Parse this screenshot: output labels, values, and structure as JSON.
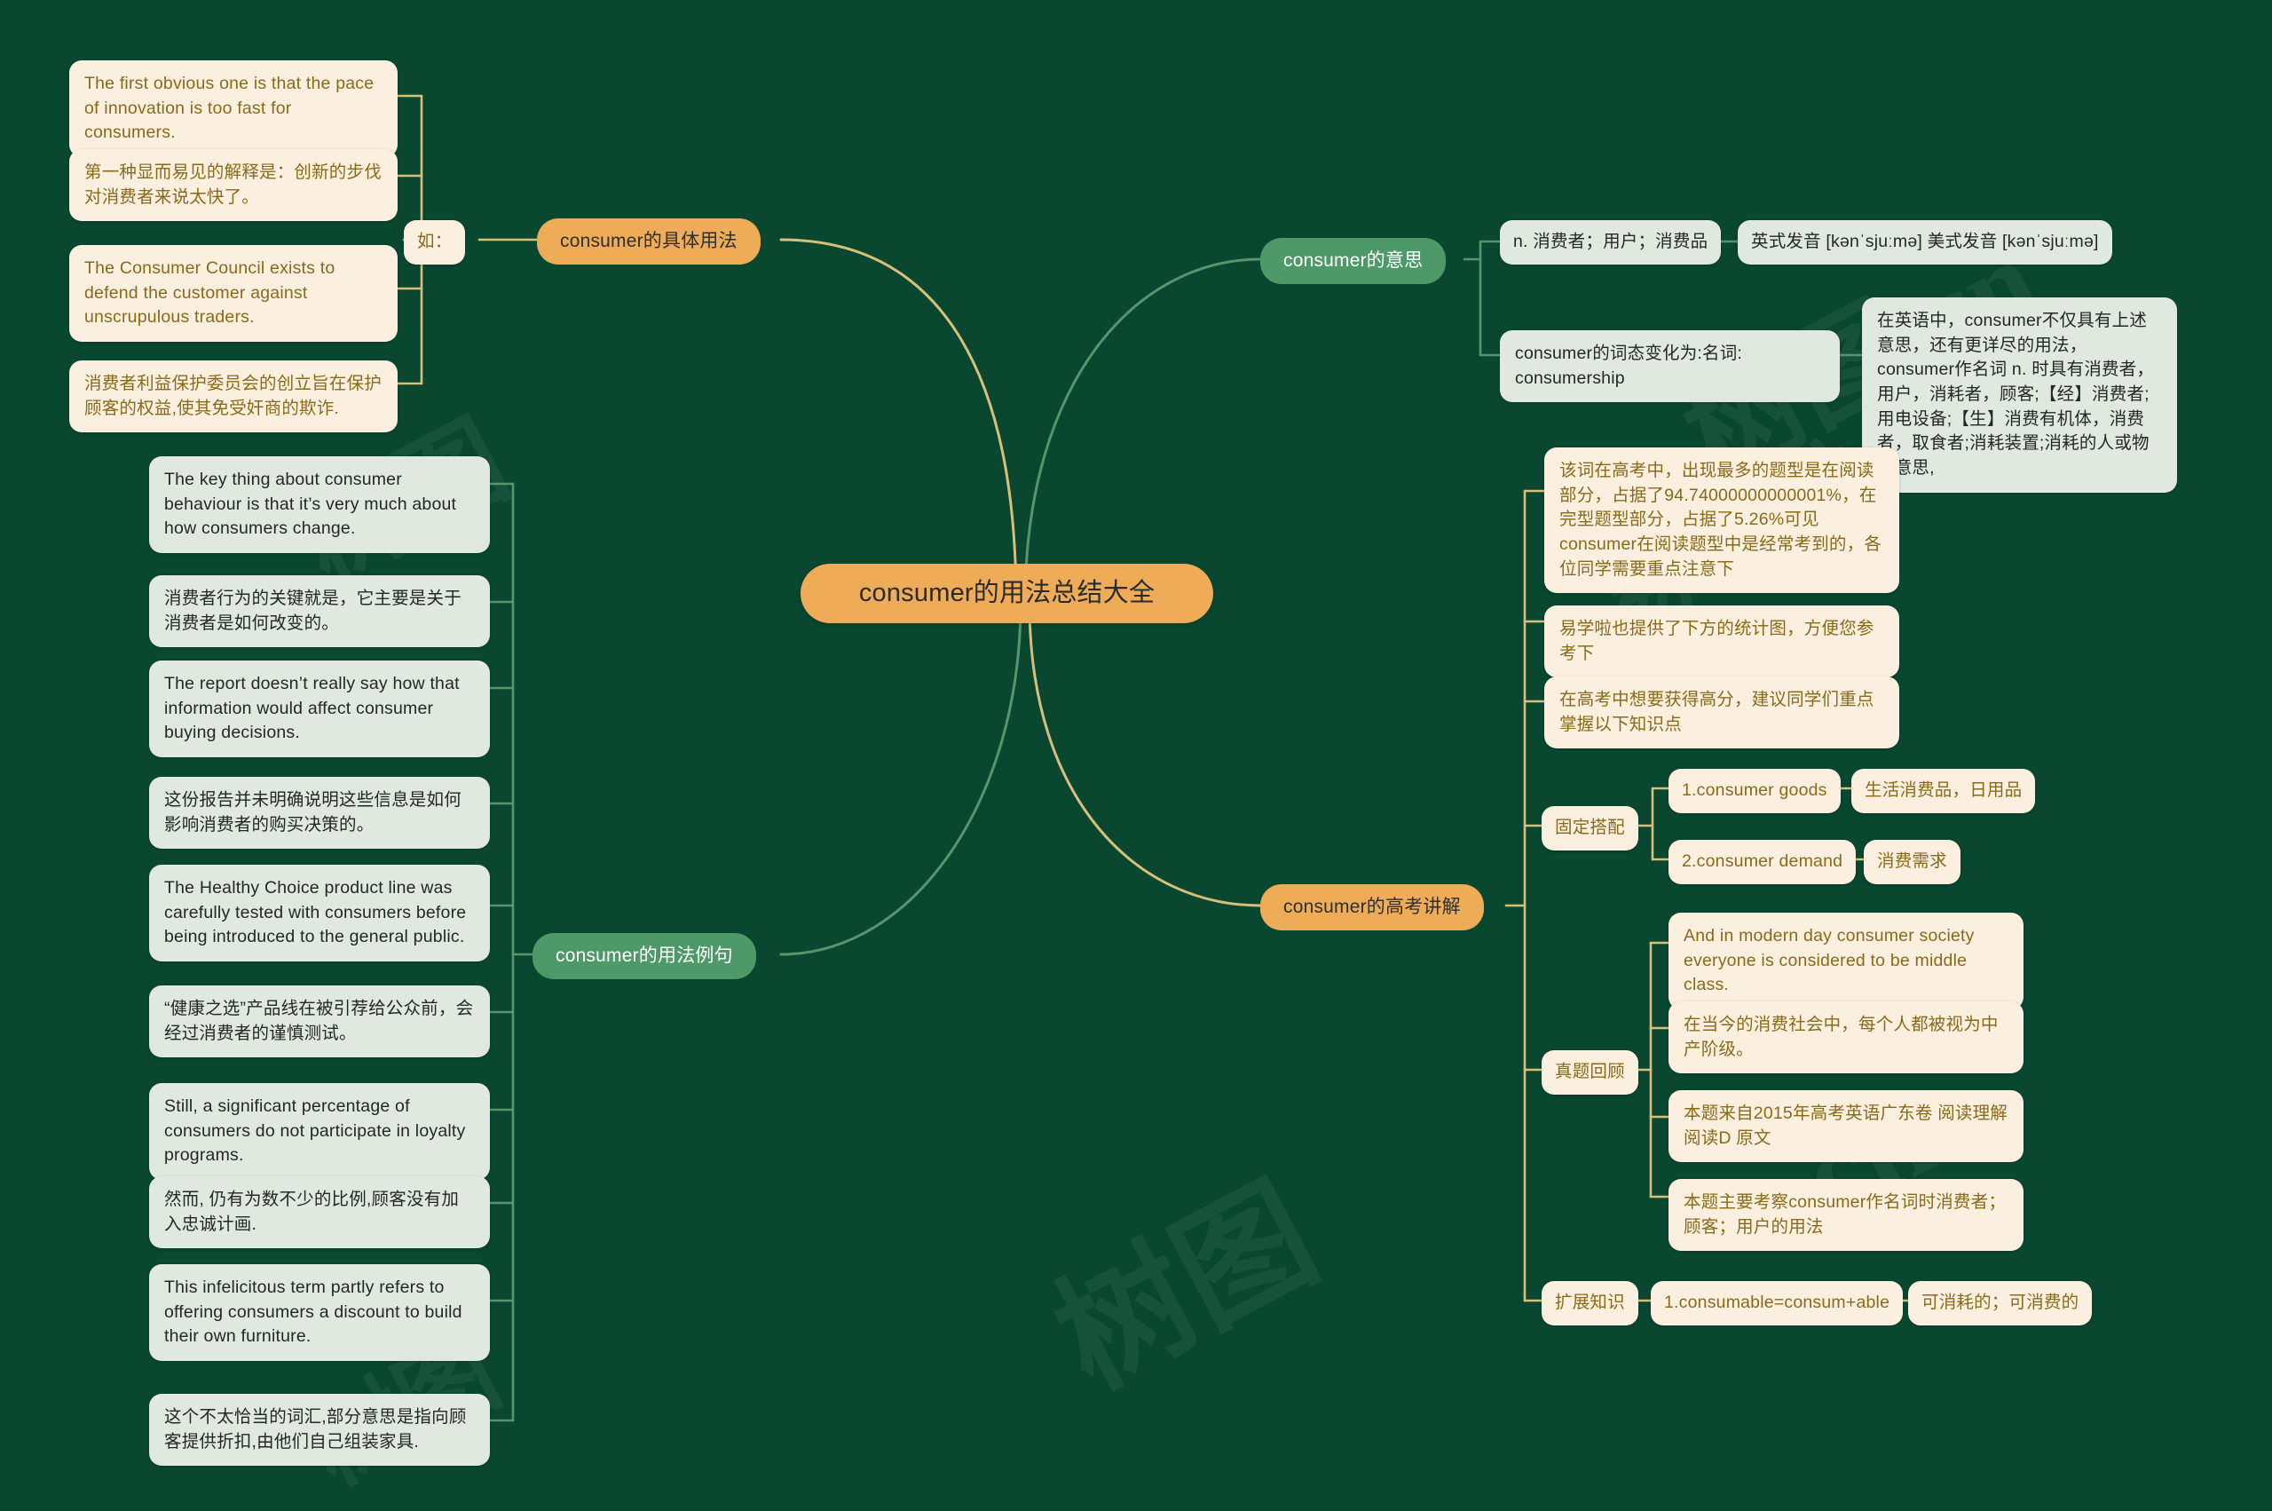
{
  "root": {
    "label": "consumer的用法总结大全"
  },
  "branches": {
    "usage": {
      "label": "consumer的具体用法",
      "connector_label": "如：",
      "cards": [
        {
          "text": "The first obvious one is that the pace of innovation is too fast for consumers."
        },
        {
          "text": "第一种显而易见的解释是：创新的步伐对消费者来说太快了。"
        },
        {
          "text": "The Consumer Council exists to defend the customer against unscrupulous traders."
        },
        {
          "text": "消费者利益保护委员会的创立旨在保护顾客的权益,使其免受奸商的欺诈."
        }
      ]
    },
    "examples": {
      "label": "consumer的用法例句",
      "cards": [
        {
          "text": "The key thing about consumer behaviour is that it’s very much about how consumers change."
        },
        {
          "text": "消费者行为的关键就是，它主要是关于消费者是如何改变的。"
        },
        {
          "text": "The report doesn’t really say how that information would affect consumer buying decisions."
        },
        {
          "text": "这份报告并未明确说明这些信息是如何影响消费者的购买决策的。"
        },
        {
          "text": "The Healthy Choice product line was carefully tested with consumers before being introduced to the general public."
        },
        {
          "text": "“健康之选”产品线在被引荐给公众前，会经过消费者的谨慎测试。"
        },
        {
          "text": "Still, a significant percentage of consumers do not participate in loyalty programs."
        },
        {
          "text": "然而, 仍有为数不少的比例,顾客没有加入忠诚计画."
        },
        {
          "text": "This infelicitous term partly refers to offering consumers a discount to build their own furniture."
        },
        {
          "text": "这个不太恰当的词汇,部分意思是指向顾客提供折扣,由他们自己组装家具."
        }
      ]
    },
    "meaning": {
      "label": "consumer的意思",
      "definition": "n. 消费者；用户；消费品",
      "pronunciation": "英式发音 [kənˈsjuːmə] 美式发音 [kənˈsjuːmə]",
      "morphology": "consumer的词态变化为:名词: consumership",
      "note": "在英语中，consumer不仅具有上述意思，还有更详尽的用法，consumer作名词 n. 时具有消费者，用户，消耗者，顾客;【经】消费者;用电设备;【生】消费有机体，消费者，取食者;消耗装置;消耗的人或物等意思,"
    },
    "gaokao": {
      "label": "consumer的高考讲解",
      "intro_cards": [
        {
          "text": "该词在高考中，出现最多的题型是在阅读部分，占据了94.74000000000001%，在完型题型部分，占据了5.26%可见consumer在阅读题型中是经常考到的，各位同学需要重点注意下"
        },
        {
          "text": "易学啦也提供了下方的统计图，方便您参考下"
        },
        {
          "text": "在高考中想要获得高分，建议同学们重点掌握以下知识点"
        }
      ],
      "collocations": {
        "label": "固定搭配",
        "items": [
          {
            "term": "1.consumer goods",
            "meaning": "生活消费品，日用品"
          },
          {
            "term": "2.consumer demand",
            "meaning": "消费需求"
          }
        ]
      },
      "past_questions": {
        "label": "真题回顾",
        "cards": [
          {
            "text": "And in modern day consumer society everyone is considered to be middle class."
          },
          {
            "text": "在当今的消费社会中，每个人都被视为中产阶级。"
          },
          {
            "text": "本题来自2015年高考英语广东卷 阅读理解 阅读D 原文"
          },
          {
            "text": "本题主要考察consumer作名词时消费者；顾客；用户的用法"
          }
        ]
      },
      "extension": {
        "label": "扩展知识",
        "items": [
          {
            "term": "1.consumable=consum+able",
            "meaning": "可消耗的；可消费的"
          }
        ]
      }
    }
  },
  "colors": {
    "background": "#0a4731",
    "accent_orange": "#eeac59",
    "accent_green": "#4e9968",
    "card_cream": "#fbf0e0",
    "card_mint": "#dfe9df",
    "link_gold": "#d8c07a",
    "link_green": "#59946c",
    "text_gold": "#8a6a18"
  }
}
